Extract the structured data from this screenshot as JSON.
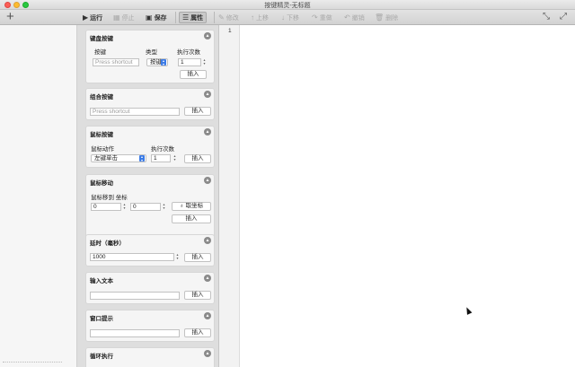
{
  "window": {
    "title": "按键精灵-无标题"
  },
  "toolbar": {
    "add_label": "+",
    "run": "运行",
    "stop": "停止",
    "save": "保存",
    "properties": "属性",
    "modify": "修改",
    "move_up": "上移",
    "move_down": "下移",
    "redo": "重做",
    "undo": "撤销",
    "delete": "删除"
  },
  "sections": {
    "keyboard": {
      "title": "键盘按键",
      "key_label": "按键",
      "type_label": "类型",
      "count_label": "执行次数",
      "key_placeholder": "Press shortcut",
      "type_value": "按键",
      "count_value": "1",
      "insert": "插入"
    },
    "combo": {
      "title": "组合按键",
      "placeholder": "Press shortcut",
      "insert": "插入"
    },
    "mouse_button": {
      "title": "鼠标按键",
      "action_label": "鼠标动作",
      "count_label": "执行次数",
      "action_value": "左键单击",
      "count_value": "1",
      "insert": "插入"
    },
    "mouse_move": {
      "title": "鼠标移动",
      "coord_label": "鼠标移到 坐标",
      "x_value": "0",
      "y_value": "0",
      "get_coord": "取坐标",
      "insert": "插入"
    },
    "delay": {
      "title": "延时（毫秒）",
      "value": "1000",
      "insert": "插入"
    },
    "input_text": {
      "title": "输入文本",
      "value": "",
      "insert": "插入"
    },
    "window_tip": {
      "title": "窗口提示",
      "value": "",
      "insert": "插入"
    },
    "loop": {
      "title": "循环执行"
    }
  },
  "editor": {
    "line_number": "1"
  }
}
